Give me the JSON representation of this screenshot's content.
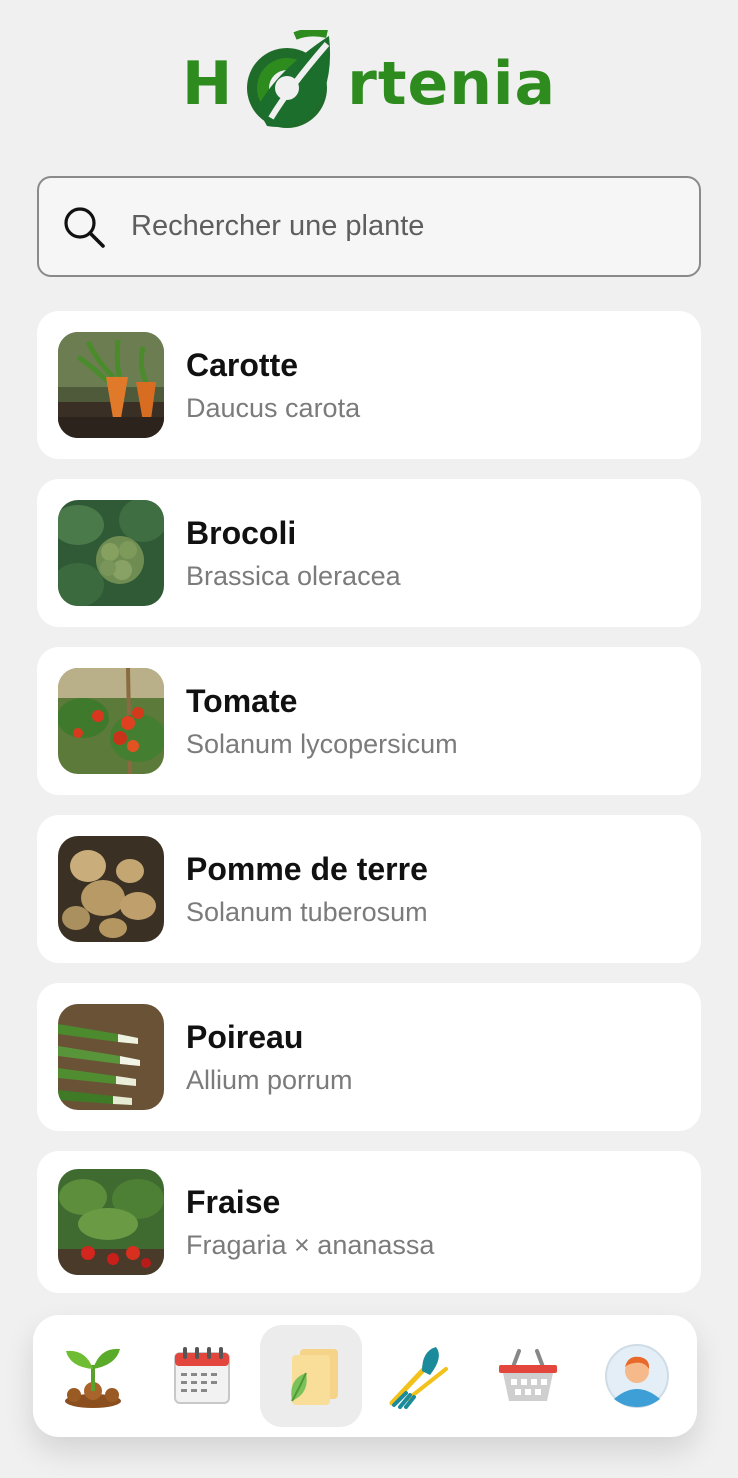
{
  "app": {
    "logo_left": "H",
    "logo_right": "rtenia"
  },
  "search": {
    "placeholder": "Rechercher une plante",
    "icon": "search-icon"
  },
  "plants": [
    {
      "name": "Carotte",
      "latin": "Daucus carota",
      "image": "carrot-photo"
    },
    {
      "name": "Brocoli",
      "latin": "Brassica oleracea",
      "image": "broccoli-photo"
    },
    {
      "name": "Tomate",
      "latin": "Solanum lycopersicum",
      "image": "tomato-photo"
    },
    {
      "name": "Pomme de terre",
      "latin": "Solanum tuberosum",
      "image": "potato-photo"
    },
    {
      "name": "Poireau",
      "latin": "Allium porrum",
      "image": "leek-photo"
    },
    {
      "name": "Fraise",
      "latin": "Fragaria × ananassa",
      "image": "strawberry-photo"
    }
  ],
  "nav": {
    "items": [
      {
        "icon": "sprout-icon",
        "active": false
      },
      {
        "icon": "calendar-icon",
        "active": false
      },
      {
        "icon": "plant-cards-icon",
        "active": true
      },
      {
        "icon": "garden-tools-icon",
        "active": false
      },
      {
        "icon": "basket-icon",
        "active": false
      },
      {
        "icon": "profile-avatar-icon",
        "active": false
      }
    ]
  },
  "colors": {
    "brand": "#2e8b1e",
    "background": "#f0f0f0",
    "card": "#ffffff",
    "latin_text": "#7b7b7b"
  }
}
